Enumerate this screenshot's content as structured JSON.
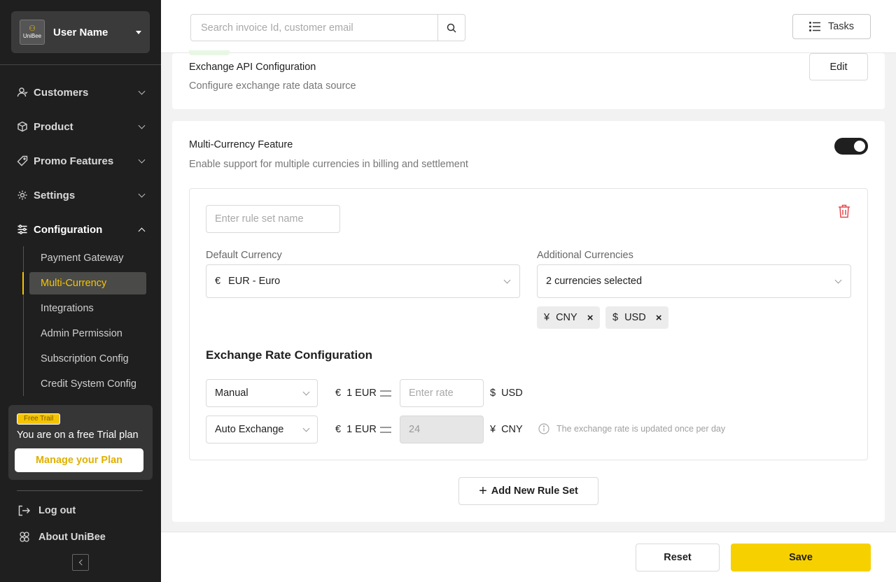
{
  "user": {
    "logo_text": "UniBee",
    "name": "User Name"
  },
  "nav": {
    "items": [
      {
        "label": "Customers",
        "icon": "user-icon"
      },
      {
        "label": "Product",
        "icon": "box-icon"
      },
      {
        "label": "Promo Features",
        "icon": "tag-icon"
      },
      {
        "label": "Settings",
        "icon": "gear-icon"
      },
      {
        "label": "Configuration",
        "icon": "sliders-icon"
      }
    ],
    "config_sub": [
      "Payment Gateway",
      "Multi-Currency",
      "Integrations",
      "Admin Permission",
      "Subscription Config",
      "Credit System Config"
    ]
  },
  "trial": {
    "badge": "Free Trail",
    "text": "You are on a free Trial plan",
    "button": "Manage your Plan"
  },
  "bottom": {
    "logout": "Log out",
    "about": "About UniBee"
  },
  "topbar": {
    "search_placeholder": "Search invoice Id, customer email",
    "tasks": "Tasks"
  },
  "exchange_api": {
    "title": "Exchange API Configuration",
    "desc": "Configure exchange rate data source",
    "edit": "Edit"
  },
  "multi_currency": {
    "title": "Multi-Currency Feature",
    "desc": "Enable support for multiple currencies in billing and settlement",
    "enabled": true,
    "rule_name_placeholder": "Enter rule set name",
    "default_label": "Default Currency",
    "default_symbol": "€",
    "default_value": "EUR - Euro",
    "additional_label": "Additional Currencies",
    "additional_value": "2 currencies selected",
    "tags": [
      {
        "symbol": "¥",
        "code": "CNY",
        "remove": "×"
      },
      {
        "symbol": "$",
        "code": "USD",
        "remove": "×"
      }
    ],
    "section_title": "Exchange Rate Configuration",
    "rates": [
      {
        "mode": "Manual",
        "from_symbol": "€",
        "from": "1 EUR",
        "placeholder": "Enter rate",
        "value": "",
        "to_symbol": "$",
        "to": "USD"
      },
      {
        "mode": "Auto Exchange",
        "from_symbol": "€",
        "from": "1 EUR",
        "placeholder": "",
        "value": "24",
        "to_symbol": "¥",
        "to": "CNY"
      }
    ],
    "info_note": "The exchange rate is updated once per day",
    "add_rule": "Add New Rule Set"
  },
  "footer": {
    "reset": "Reset",
    "save": "Save"
  },
  "colors": {
    "accent": "#f7d000",
    "sidebar": "#1f1f1f",
    "danger": "#e5484d"
  }
}
